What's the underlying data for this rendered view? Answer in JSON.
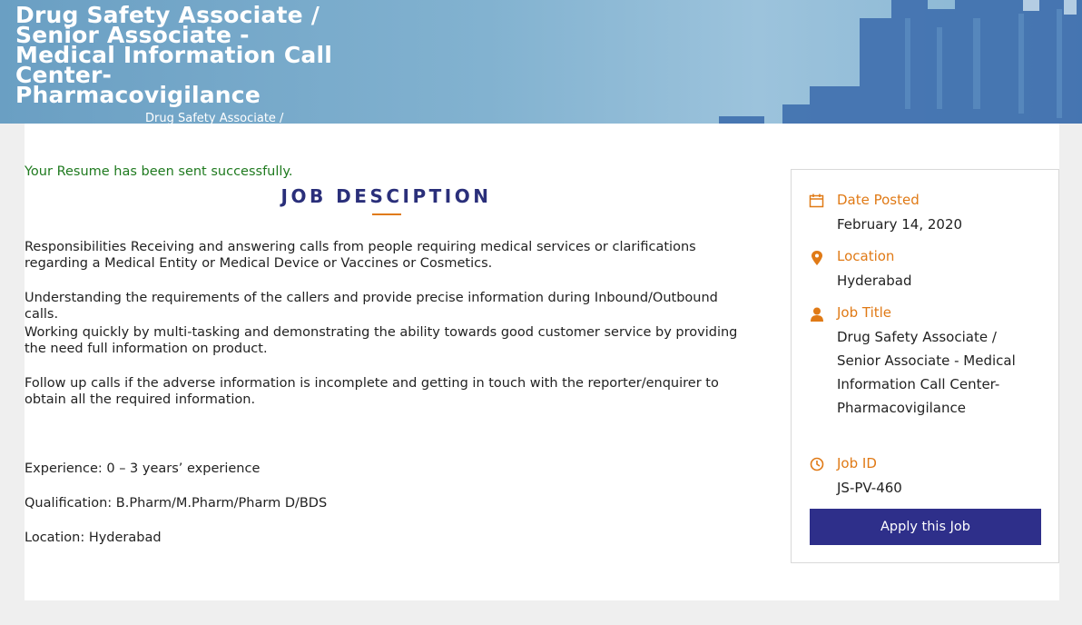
{
  "banner": {
    "title_lines": [
      "Drug Safety Associate /",
      "Senior Associate -",
      "Medical Information Call Center-",
      "Pharmacovigilance"
    ],
    "breadcrumb": "Drug Safety Associate /"
  },
  "main": {
    "success_message": "Your Resume has been sent successfully.",
    "heading": "JOB DESCIPTION",
    "paragraphs": [
      "Responsibilities Receiving and answering calls from people requiring medical services or clarifications regarding a Medical Entity or Medical Device or Vaccines or Cosmetics.",
      "Understanding the requirements of the callers and provide precise information during Inbound/Outbound calls.",
      "Working quickly by multi-tasking and demonstrating the ability towards good customer service by providing the need full information on product.",
      "Follow up calls if the adverse information is incomplete and getting in touch with the reporter/enquirer to obtain all the required information.",
      "Experience: 0 – 3 years’ experience",
      "Qualification: B.Pharm/M.Pharm/Pharm D/BDS",
      "Location: Hyderabad"
    ]
  },
  "sidebar": {
    "date_posted": {
      "label": "Date Posted",
      "value": "February 14, 2020",
      "icon": "calendar-icon"
    },
    "location": {
      "label": "Location",
      "value": "Hyderabad",
      "icon": "map-marker-icon"
    },
    "job_title": {
      "label": "Job Title",
      "value": "Drug Safety Associate / Senior Associate - Medical Information Call Center-Pharmacovigilance",
      "icon": "user-icon"
    },
    "job_id": {
      "label": "Job ID",
      "value": "JS-PV-460",
      "icon": "clock-icon"
    },
    "apply_label": "Apply this Job"
  },
  "colors": {
    "accent": "#e07a16",
    "heading": "#2a2f7a",
    "button": "#2e2f8a",
    "success": "#1f7a1f"
  }
}
